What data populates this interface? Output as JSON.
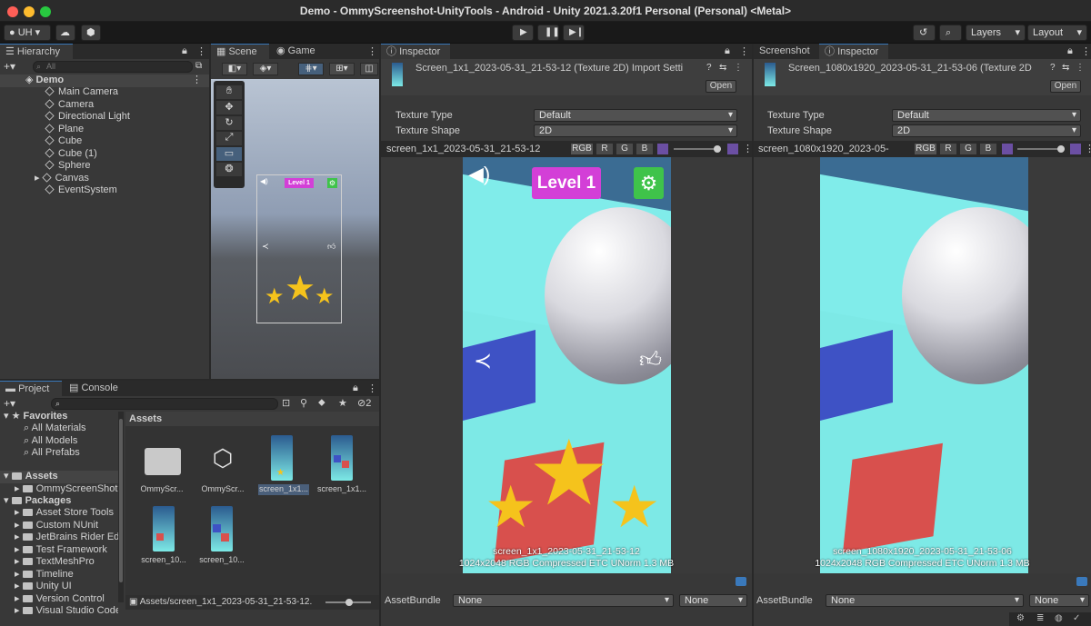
{
  "window": {
    "title": "Demo - OmmyScreenshot-UnityTools - Android - Unity 2021.3.20f1 Personal (Personal) <Metal>"
  },
  "toolbar": {
    "account": "UH",
    "layers": "Layers",
    "layout": "Layout"
  },
  "hierarchy": {
    "tab": "Hierarchy",
    "search_placeholder": "All",
    "scene": "Demo",
    "items": [
      "Main Camera",
      "Camera",
      "Directional Light",
      "Plane",
      "Cube",
      "Cube (1)",
      "Sphere",
      "Canvas",
      "EventSystem"
    ]
  },
  "scene_view": {
    "tab_scene": "Scene",
    "tab_game": "Game",
    "level_label": "Level 1"
  },
  "project": {
    "tab_project": "Project",
    "tab_console": "Console",
    "hidden_count": "2",
    "favorites_label": "Favorites",
    "favorites": [
      "All Materials",
      "All Models",
      "All Prefabs"
    ],
    "assets_label": "Assets",
    "assets_child": "OmmyScreenShot",
    "packages_label": "Packages",
    "packages": [
      "Asset Store Tools",
      "Custom NUnit",
      "JetBrains Rider Ed",
      "Test Framework",
      "TextMeshPro",
      "Timeline",
      "Unity UI",
      "Version Control",
      "Visual Studio Code"
    ],
    "grid_header": "Assets",
    "grid_items": [
      "OmmyScr...",
      "OmmyScr...",
      "screen_1x1...",
      "screen_1x1...",
      "screen_10...",
      "screen_10..."
    ],
    "footer_path": "Assets/screen_1x1_2023-05-31_21-53-12."
  },
  "inspector1": {
    "tab": "Inspector",
    "title": "Screen_1x1_2023-05-31_21-53-12 (Texture 2D) Import Setti",
    "open_label": "Open",
    "texture_type_label": "Texture Type",
    "texture_type": "Default",
    "texture_shape_label": "Texture Shape",
    "texture_shape": "2D",
    "preview_name": "screen_1x1_2023-05-31_21-53-12",
    "channels": [
      "RGB",
      "R",
      "G",
      "B"
    ],
    "level_label": "Level 1",
    "caption_name": "screen_1x1_2023-05-31_21-53-12",
    "caption_info": "1024x2048  RGB Compressed ETC UNorm  1.3 MB",
    "assetbundle_label": "AssetBundle",
    "assetbundle_value": "None",
    "assetbundle_variant": "None"
  },
  "inspector2": {
    "tab_screenshot": "Screenshot",
    "tab": "Inspector",
    "title": "Screen_1080x1920_2023-05-31_21-53-06 (Texture 2D",
    "open_label": "Open",
    "texture_type_label": "Texture Type",
    "texture_type": "Default",
    "texture_shape_label": "Texture Shape",
    "texture_shape": "2D",
    "preview_name": "screen_1080x1920_2023-05-",
    "channels": [
      "RGB",
      "R",
      "G",
      "B"
    ],
    "caption_name": "screen_1080x1920_2023-05-31_21-53-06",
    "caption_info": "1024x2048  RGB Compressed ETC UNorm  1.3 MB",
    "assetbundle_label": "AssetBundle",
    "assetbundle_value": "None",
    "assetbundle_variant": "None"
  },
  "colors": {
    "accent": "#3a79bb",
    "level_badge": "#d33fd7",
    "settings_green": "#3fc34a",
    "game_bg": "#7de9e6",
    "star": "#f5c31c"
  }
}
